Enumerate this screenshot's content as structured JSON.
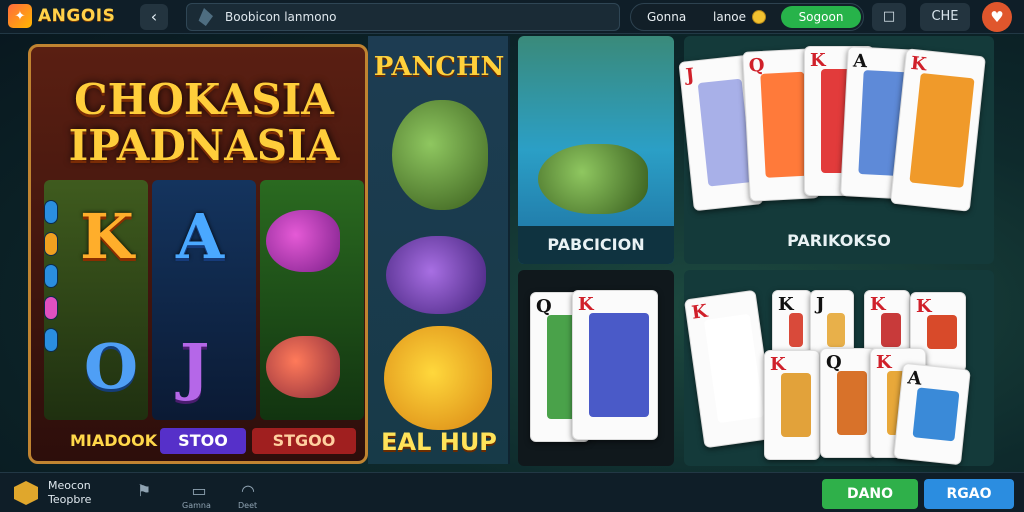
{
  "header": {
    "logo_text": "ANGOIS",
    "back_icon": "chevron-left-icon",
    "search_text": "Boobicon lanmono",
    "pill_a": "Gonna",
    "pill_b": "lanoe",
    "pill_c": "Sogoon",
    "icon_1": "□",
    "icon_2": "CHE",
    "avatar_icon": "⬤"
  },
  "slot": {
    "title_line1": "CHOKASIA",
    "title_line2": "IPADNASIA",
    "symbols": [
      "K",
      "A",
      "O",
      "J"
    ],
    "labels": [
      "MIADOOK",
      "STOO",
      "STGOO"
    ]
  },
  "fish_column": {
    "title": "PANCHN",
    "label": "EAL HUP"
  },
  "panels": {
    "water_label": "PABCICION",
    "cards_label": "PARIKOKSO"
  },
  "cards_top": [
    {
      "rank": "J",
      "color": "red",
      "art": "#a8b0e8"
    },
    {
      "rank": "Q",
      "color": "red",
      "art": "#ff7a3a"
    },
    {
      "rank": "K",
      "color": "red",
      "art": "#e23b3b"
    },
    {
      "rank": "A",
      "color": "blk",
      "art": "#5e8ad8"
    },
    {
      "rank": "K",
      "color": "red",
      "art": "#f09a2a"
    }
  ],
  "card_panel": [
    {
      "rank": "Q",
      "color": "blk",
      "art": "#4aa24a"
    },
    {
      "rank": "K",
      "color": "red",
      "art": "#4a5ac8"
    }
  ],
  "cards_bottom": [
    {
      "rank": "K",
      "color": "red",
      "art": "#ffffff"
    },
    {
      "rank": "K",
      "color": "blk",
      "art": "#d94a3a"
    },
    {
      "rank": "J",
      "color": "blk",
      "art": "#e8b04a"
    },
    {
      "rank": "K",
      "color": "red",
      "art": "#c83a3a"
    },
    {
      "rank": "K",
      "color": "red",
      "art": "#d84a2a"
    },
    {
      "rank": "K",
      "color": "red",
      "art": "#e2a23a"
    },
    {
      "rank": "Q",
      "color": "blk",
      "art": "#d8722a"
    },
    {
      "rank": "K",
      "color": "red",
      "art": "#e8a83a"
    },
    {
      "rank": "A",
      "color": "blk",
      "art": "#3a8ad8"
    }
  ],
  "footer": {
    "text_line1": "Meocon",
    "text_line2": "Teopbre",
    "icon_labels": [
      "Gamna",
      "Deet"
    ],
    "btn_green": "DANO",
    "btn_blue": "RGAO"
  }
}
